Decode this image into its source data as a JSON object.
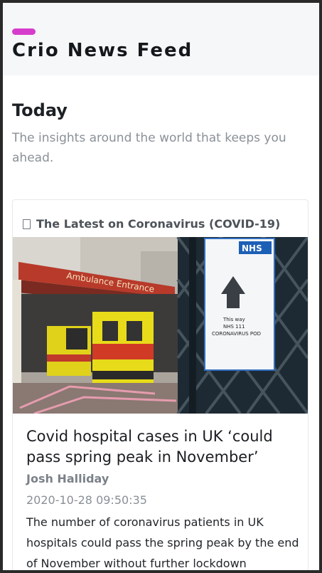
{
  "app": {
    "title": "Crio News Feed",
    "accent_color": "#d63dcc"
  },
  "intro": {
    "title": "Today",
    "subtitle": "The insights around the world that keeps you ahead."
  },
  "topic_card": {
    "icon": "document-icon",
    "title": "The Latest on Coronavirus (COVID-19)",
    "article": {
      "image_sign_lines": [
        "This way",
        "NHS 111",
        "CORONAVIRUS POD"
      ],
      "image_entrance_label": "Ambulance Entrance",
      "image_nhs_label": "NHS",
      "headline": "Covid hospital cases in UK ‘could pass spring peak in November’",
      "author": "Josh Halliday",
      "timestamp": "2020-10-28 09:50:35",
      "description": "The number of coronavirus patients in UK hospitals could pass the spring peak by the end of November without further lockdown"
    }
  }
}
